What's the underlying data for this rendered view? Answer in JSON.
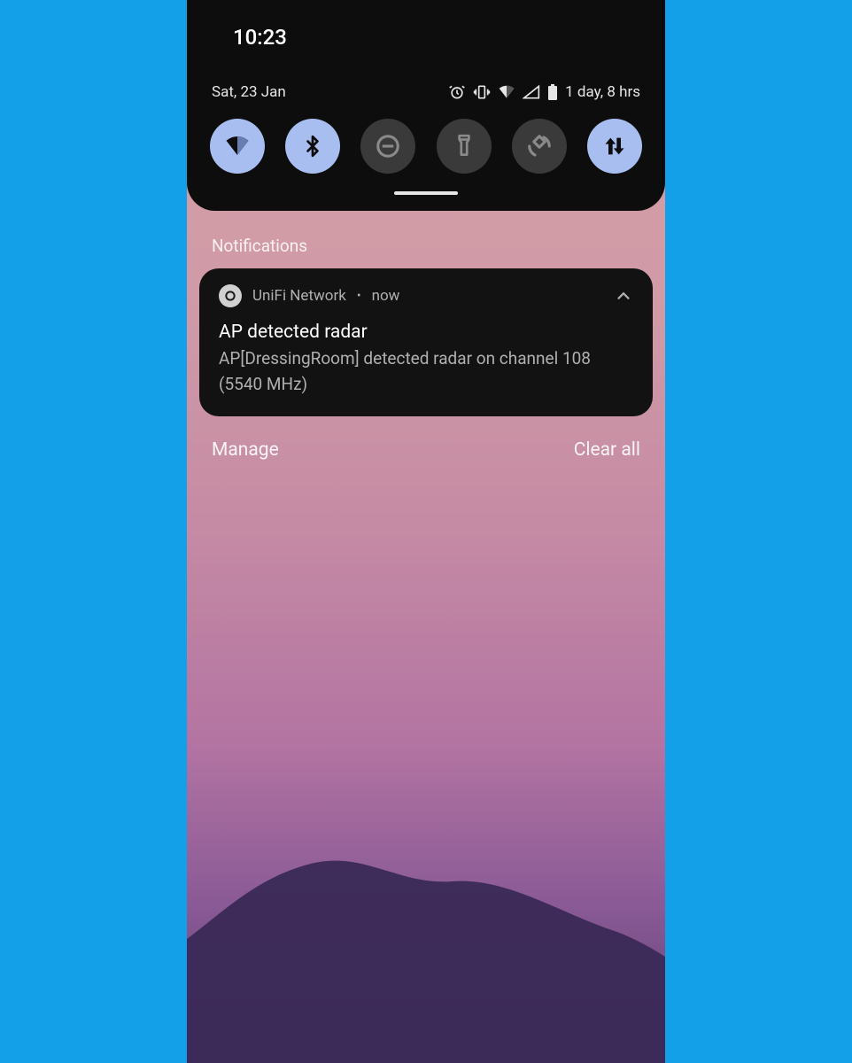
{
  "statusbar": {
    "time": "10:23",
    "date": "Sat, 23 Jan",
    "battery_text": "1 day, 8 hrs"
  },
  "tiles": {
    "wifi": "wifi",
    "bluetooth": "bluetooth",
    "dnd": "dnd",
    "flashlight": "flashlight",
    "autorotate": "autorotate",
    "data": "data"
  },
  "sections": {
    "notifications_label": "Notifications"
  },
  "notification": {
    "app": "UniFi Network",
    "time": "now",
    "title": "AP detected radar",
    "body": "AP[DressingRoom] detected radar on channel 108 (5540 MHz)"
  },
  "footer": {
    "manage": "Manage",
    "clear_all": "Clear all"
  }
}
